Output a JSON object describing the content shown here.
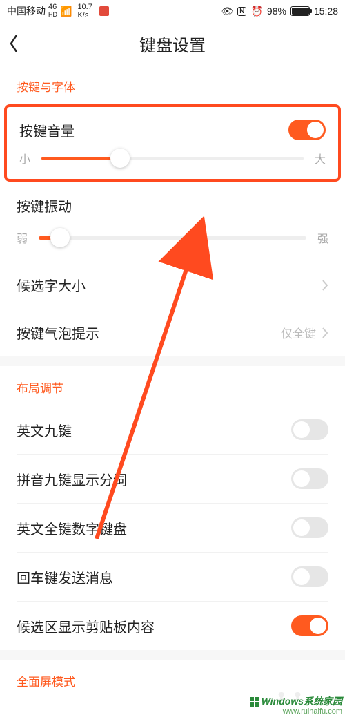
{
  "status": {
    "carrier": "中国移动",
    "net": "46",
    "hd": "HD",
    "speed_top": "10.7",
    "speed_bottom": "K/s",
    "battery_pct": "98%",
    "time": "15:28"
  },
  "header": {
    "title": "键盘设置"
  },
  "section1": {
    "label": "按键与字体",
    "volume_label": "按键音量",
    "volume_toggle": true,
    "volume_slider": {
      "min_label": "小",
      "max_label": "大",
      "value_pct": 30
    },
    "vibration_label": "按键振动",
    "vibration_slider": {
      "min_label": "弱",
      "max_label": "强",
      "value_pct": 8
    },
    "candidate_size_label": "候选字大小",
    "bubble_label": "按键气泡提示",
    "bubble_value": "仅全键"
  },
  "section2": {
    "label": "布局调节",
    "items": [
      {
        "label": "英文九键",
        "toggle": false
      },
      {
        "label": "拼音九键显示分词",
        "toggle": false
      },
      {
        "label": "英文全键数字键盘",
        "toggle": false
      },
      {
        "label": "回车键发送消息",
        "toggle": false
      },
      {
        "label": "候选区显示剪贴板内容",
        "toggle": true
      }
    ]
  },
  "section3": {
    "label": "全面屏模式"
  },
  "watermark": {
    "line1": "Windows系统家园",
    "line2": "www.ruihaifu.com"
  }
}
